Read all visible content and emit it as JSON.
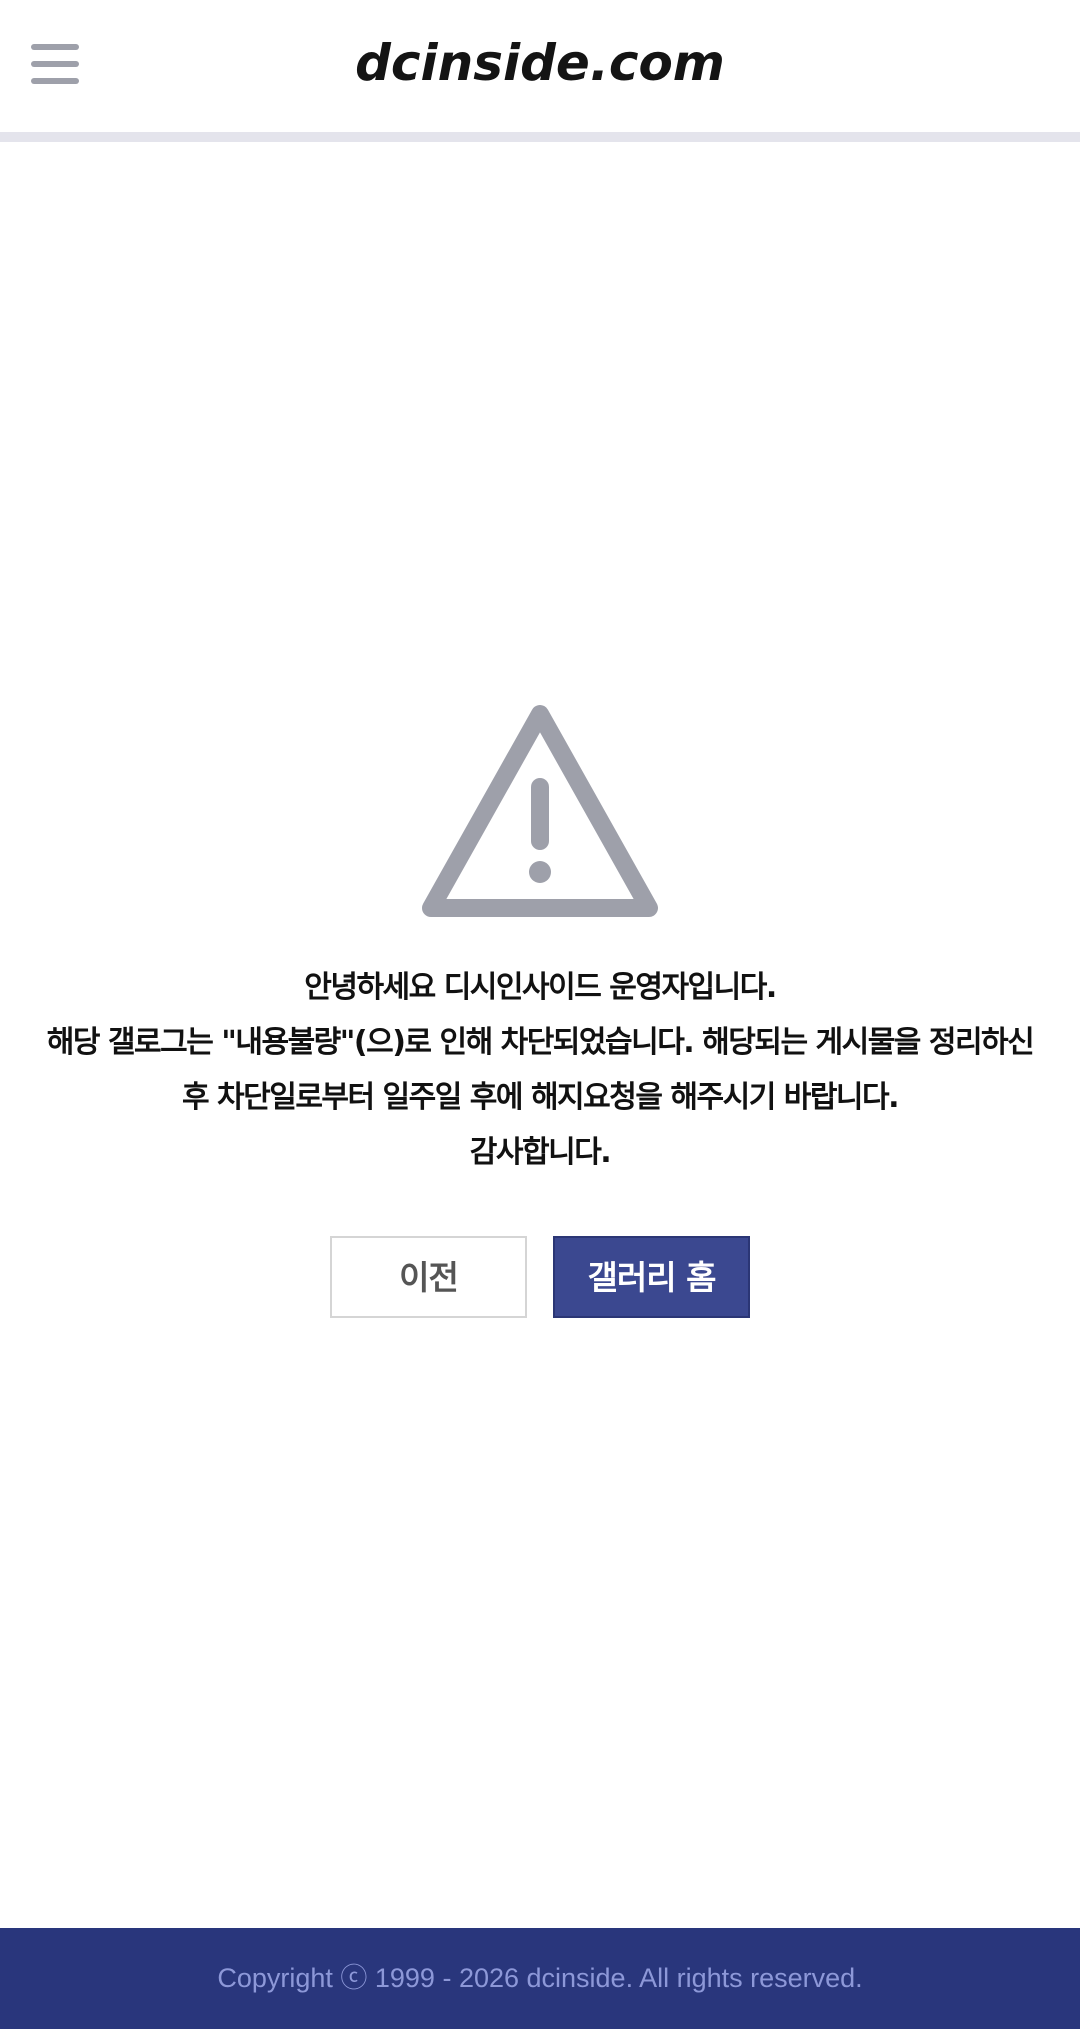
{
  "header": {
    "logo_text": "dcinside.com",
    "menu_icon": "hamburger-menu-icon"
  },
  "notice": {
    "icon": "warning-triangle-icon",
    "lines": [
      "안녕하세요 디시인사이드 운영자입니다.",
      "해당 갤로그는 \"내용불량\"(으)로 인해 차단되었습니다. 해당되는 게시물을 정리하신 후 차단일로부터 일주일 후에 해지요청을 해주시기 바랍니다.",
      "감사합니다."
    ]
  },
  "actions": {
    "prev_label": "이전",
    "home_label": "갤러리 홈"
  },
  "footer": {
    "copyright": "Copyright ⓒ 1999 - 2026 dcinside. All rights reserved."
  },
  "colors": {
    "brand": "#29367c",
    "button_primary": "#3b4890",
    "icon_gray": "#9ea0aa"
  }
}
